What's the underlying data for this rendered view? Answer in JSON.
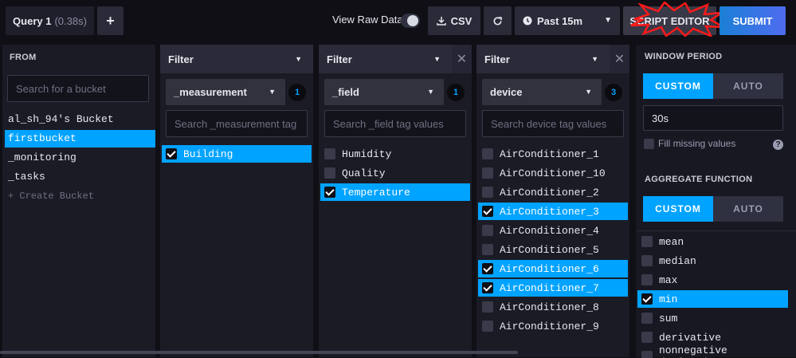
{
  "topbar": {
    "query_tab": "Query 1",
    "query_time": "(0.38s)",
    "add_query": "+",
    "view_raw_label": "View Raw Data",
    "csv_label": "CSV",
    "time_range": "Past 15m",
    "script_editor_label": "SCRIPT EDITOR",
    "submit_label": "SUBMIT"
  },
  "from": {
    "title": "FROM",
    "search_placeholder": "Search for a bucket",
    "buckets": [
      "al_sh_94's Bucket",
      "firstbucket",
      "_monitoring",
      "_tasks"
    ],
    "selected": "firstbucket",
    "create_label": "+ Create Bucket"
  },
  "filters": [
    {
      "header": "Filter",
      "key": "_measurement",
      "count": "1",
      "search_placeholder": "Search _measurement tag",
      "values": [
        "Building"
      ],
      "selected": [
        "Building"
      ]
    },
    {
      "header": "Filter",
      "key": "_field",
      "count": "1",
      "search_placeholder": "Search _field tag values",
      "values": [
        "Humidity",
        "Quality",
        "Temperature"
      ],
      "selected": [
        "Temperature"
      ]
    },
    {
      "header": "Filter",
      "key": "device",
      "count": "3",
      "search_placeholder": "Search device tag values",
      "values": [
        "AirConditioner_1",
        "AirConditioner_10",
        "AirConditioner_2",
        "AirConditioner_3",
        "AirConditioner_4",
        "AirConditioner_5",
        "AirConditioner_6",
        "AirConditioner_7",
        "AirConditioner_8",
        "AirConditioner_9"
      ],
      "selected": [
        "AirConditioner_3",
        "AirConditioner_6",
        "AirConditioner_7"
      ]
    }
  ],
  "window_period": {
    "title": "WINDOW PERIOD",
    "custom": "CUSTOM",
    "auto": "AUTO",
    "value": "30s",
    "fill_missing": "Fill missing values",
    "help": "?"
  },
  "aggregate": {
    "title": "AGGREGATE FUNCTION",
    "custom": "CUSTOM",
    "auto": "AUTO",
    "functions": [
      "mean",
      "median",
      "max",
      "min",
      "sum",
      "derivative",
      "nonnegative derivative"
    ],
    "selected": "min"
  },
  "colors": {
    "accent": "#00a3ff",
    "submit_start": "#1b7fd6",
    "submit_end": "#4f6cf0",
    "annotation": "#ff1a1a"
  }
}
